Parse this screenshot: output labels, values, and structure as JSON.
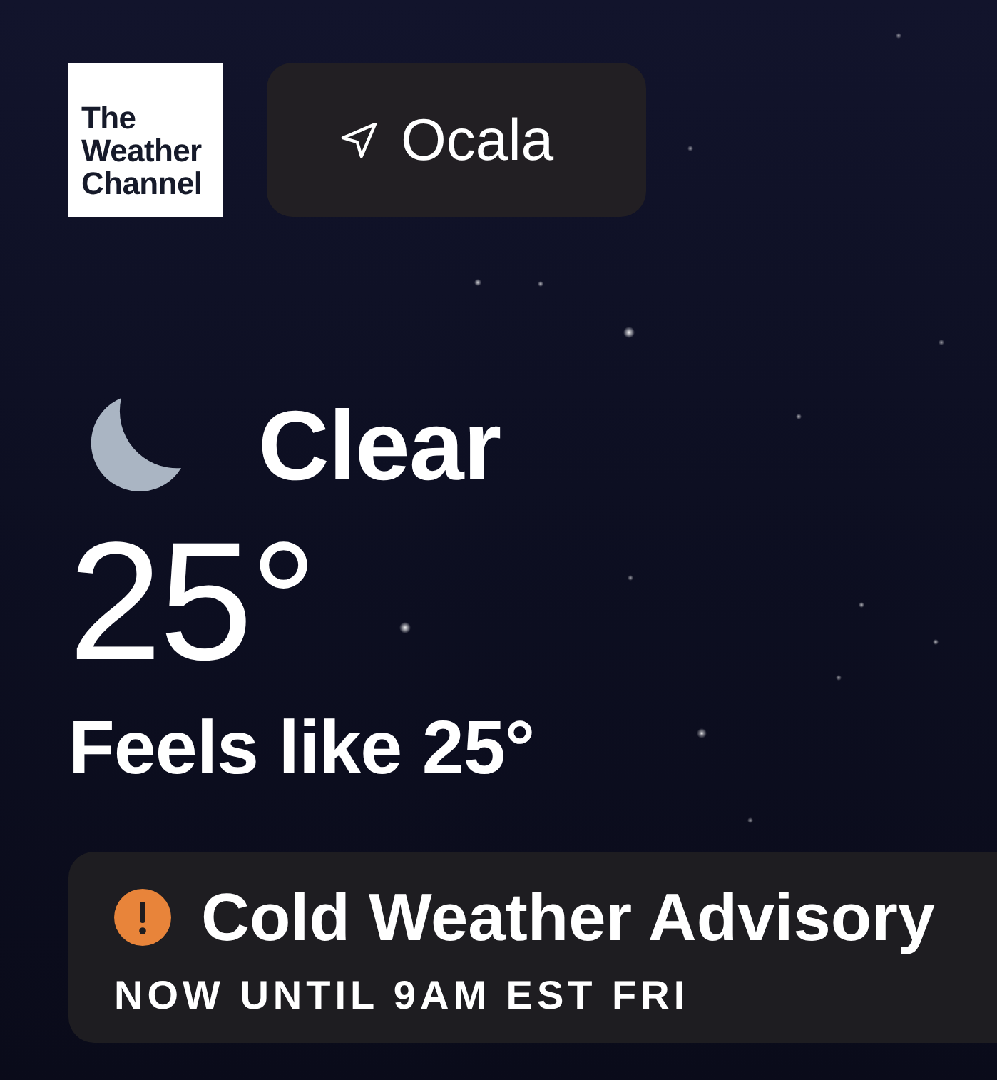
{
  "logo": {
    "lines": [
      "The",
      "Weather",
      "Channel"
    ]
  },
  "location": {
    "name": "Ocala"
  },
  "current": {
    "condition": "Clear",
    "temperature": "25°",
    "feels_like": "Feels like 25°"
  },
  "alert": {
    "title": "Cold Weather Advisory",
    "period": "NOW UNTIL 9AM EST FRI"
  }
}
